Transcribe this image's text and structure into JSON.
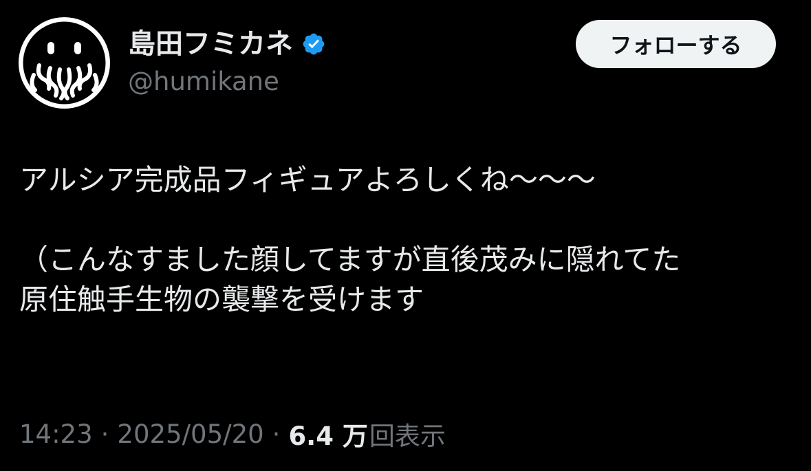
{
  "author": {
    "display_name": "島田フミカネ",
    "handle": "@humikane",
    "avatar_icon": "octopus-avatar-icon",
    "verified_icon": "verified-badge-icon"
  },
  "follow_button": {
    "label": "フォローする"
  },
  "tweet": {
    "lines": [
      "アルシア完成品フィギュアよろしくね〜〜〜",
      "",
      "（こんなすました顔してますが直後茂みに隠れてた",
      "原住触手生物の襲撃を受けます"
    ]
  },
  "meta": {
    "time": "14:23",
    "separator": "·",
    "date": "2025/05/20",
    "views_count": "6.4 万",
    "views_label": "回表示"
  },
  "colors": {
    "background": "#000000",
    "primary_text": "#e7e9ea",
    "secondary_text": "#71767b",
    "verified_blue": "#1d9bf0",
    "follow_button_bg": "#eff3f4"
  }
}
